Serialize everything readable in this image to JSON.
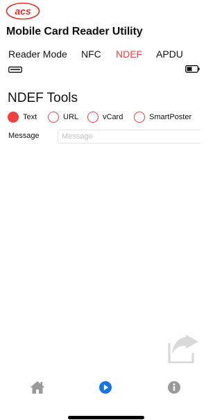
{
  "colors": {
    "accent": "#f0413e",
    "nav_active": "#1473e6",
    "nav_inactive": "#999999"
  },
  "header": {
    "logo_text": "acs",
    "title": "Mobile Card Reader Utility"
  },
  "tabs": [
    {
      "label": "Reader Mode",
      "active": false
    },
    {
      "label": "NFC",
      "active": false
    },
    {
      "label": "NDEF",
      "active": true
    },
    {
      "label": "APDU",
      "active": false
    }
  ],
  "status_icons": [
    "card-reader-icon",
    "battery-icon"
  ],
  "ndef": {
    "title": "NDEF Tools",
    "types": [
      {
        "label": "Text",
        "selected": true
      },
      {
        "label": "URL",
        "selected": false
      },
      {
        "label": "vCard",
        "selected": false
      },
      {
        "label": "SmartPoster",
        "selected": false
      }
    ],
    "message_label": "Message",
    "message_placeholder": "Message",
    "message_value": ""
  },
  "actions": {
    "share_icon": "share-icon"
  },
  "bottom_nav": [
    {
      "icon": "home-icon",
      "active": false
    },
    {
      "icon": "play-icon",
      "active": true
    },
    {
      "icon": "info-icon",
      "active": false
    }
  ]
}
